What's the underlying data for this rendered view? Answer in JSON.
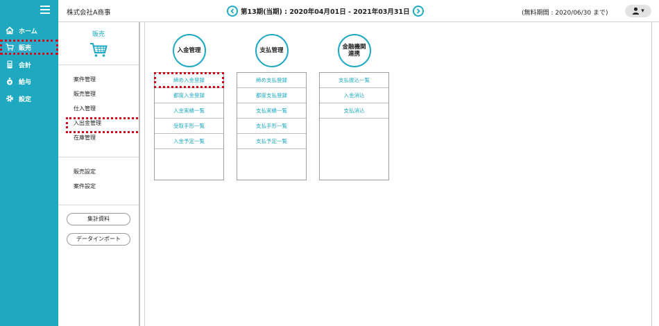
{
  "header": {
    "company": "株式会社A商事",
    "period": "第13期(当期) : 2020年04月01日 - 2021年03月31日",
    "free_period": "(無料期間 : 2020/06/30 まで)",
    "user_menu_caret": "▾"
  },
  "nav": {
    "items": [
      {
        "label": "ホーム",
        "icon": "home-icon"
      },
      {
        "label": "販売",
        "icon": "cart-icon",
        "active": true
      },
      {
        "label": "会計",
        "icon": "calculator-icon"
      },
      {
        "label": "給与",
        "icon": "money-bag-icon"
      },
      {
        "label": "設定",
        "icon": "gear-icon"
      }
    ]
  },
  "sub": {
    "title": "販売",
    "group1": [
      "案件管理",
      "販売管理",
      "仕入管理",
      "入出金管理",
      "在庫管理"
    ],
    "group2": [
      "販売設定",
      "案件設定"
    ],
    "buttons": [
      "集計資料",
      "データインポート"
    ]
  },
  "columns": [
    {
      "title": "入金管理",
      "items": [
        "締め入金登録",
        "都度入金登録",
        "入金実績一覧",
        "受取手形一覧",
        "入金予定一覧"
      ]
    },
    {
      "title": "支払管理",
      "items": [
        "締め支払登録",
        "都度支払登録",
        "支払実績一覧",
        "支払手形一覧",
        "支払予定一覧"
      ]
    },
    {
      "title": "金融機関\n連携",
      "items": [
        "支払振込一覧",
        "入金消込",
        "支払消込"
      ]
    }
  ],
  "colors": {
    "accent": "#1fa9c1",
    "highlight": "#d0021b"
  }
}
